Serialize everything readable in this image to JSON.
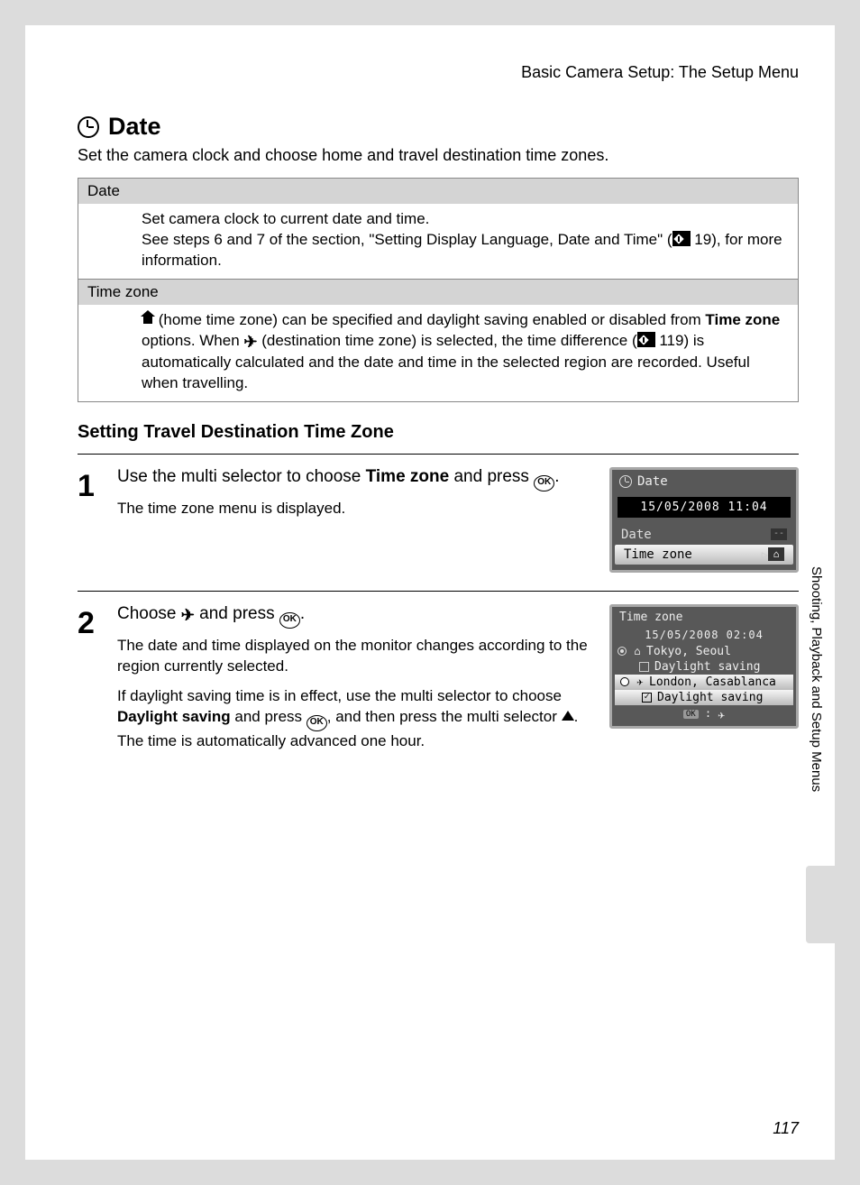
{
  "header": "Basic Camera Setup: The Setup Menu",
  "heading": "Date",
  "intro": "Set the camera clock and choose home and travel destination time zones.",
  "table": {
    "row1": {
      "head": "Date",
      "body_line1": "Set camera clock to current date and time.",
      "body_line2a": "See steps 6 and 7 of the section, \"Setting Display Language, Date and Time\" (",
      "body_line2_ref": "19",
      "body_line2b": "), for more information."
    },
    "row2": {
      "head": "Time zone",
      "frag1": " (home time zone) can be specified and daylight saving enabled or disabled from ",
      "bold": "Time zone",
      "frag2": " options. When ",
      "frag3": " (destination time zone) is selected, the time difference (",
      "ref": "119",
      "frag4": ") is automatically calculated and the date and time in the selected region are recorded. Useful when travelling."
    }
  },
  "section_title": "Setting Travel Destination Time Zone",
  "steps": {
    "s1": {
      "num": "1",
      "title_a": "Use the multi selector to choose ",
      "title_bold": "Time zone",
      "title_b": " and press ",
      "text": "The time zone menu is displayed."
    },
    "s2": {
      "num": "2",
      "title_a": "Choose ",
      "title_b": " and press ",
      "text1": "The date and time displayed on the monitor changes according to the region currently selected.",
      "text2a": "If daylight saving time is in effect, use the multi selector to choose ",
      "text2_bold": "Daylight saving",
      "text2b": " and press ",
      "text2c": ", and then press the multi selector ",
      "text2d": ". The time is automatically advanced one hour."
    }
  },
  "screen1": {
    "title": "Date",
    "datetime": "15/05/2008 11:04",
    "row_date": "Date",
    "row_tz": "Time zone"
  },
  "screen2": {
    "title": "Time zone",
    "datetime": "15/05/2008   02:04",
    "home_city": "Tokyo, Seoul",
    "dest_city": "London, Casablanca",
    "ds_label": "Daylight saving",
    "ok_label": "OK"
  },
  "sidebar": "Shooting, Playback and Setup Menus",
  "page_number": "117"
}
